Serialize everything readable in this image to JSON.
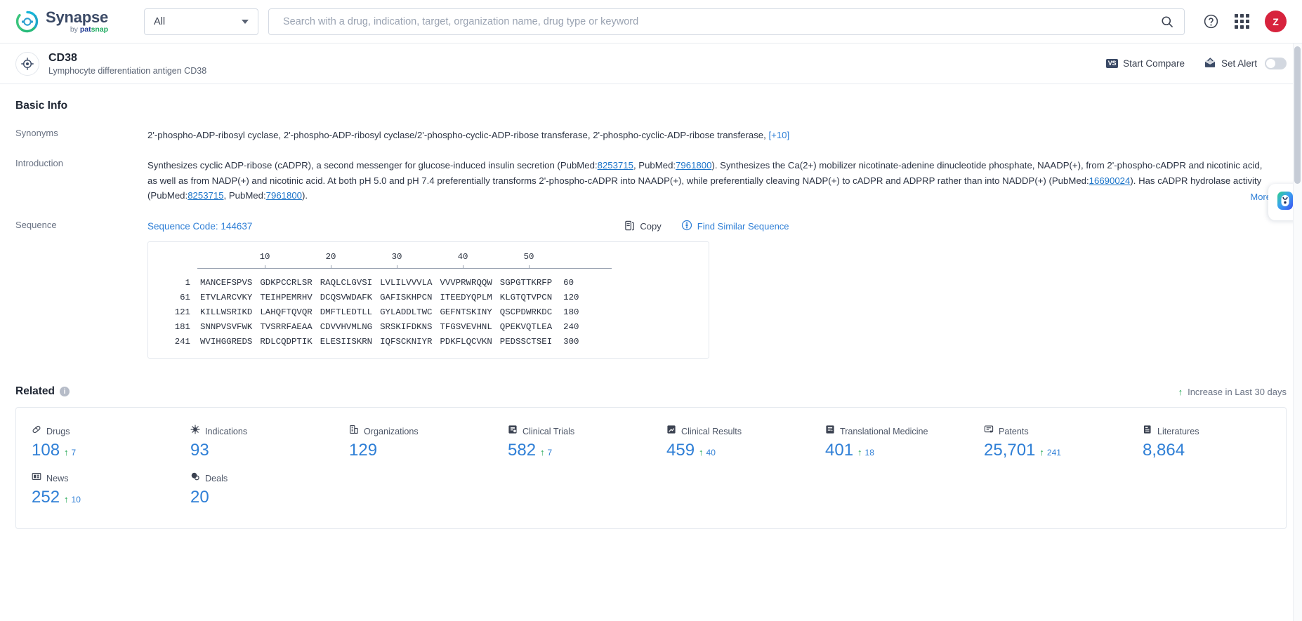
{
  "topnav": {
    "logo_name": "Synapse",
    "logo_by": "by ",
    "logo_pat": "pat",
    "logo_snap": "snap",
    "scope_value": "All",
    "search_placeholder": "Search with a drug, indication, target, organization name, drug type or keyword",
    "avatar_initial": "Z"
  },
  "subheader": {
    "entity_name": "CD38",
    "entity_desc": "Lymphocyte differentiation antigen CD38",
    "start_compare": "Start Compare",
    "vs_badge": "VS",
    "set_alert": "Set Alert"
  },
  "basic_info": {
    "title": "Basic Info",
    "synonyms_label": "Synonyms",
    "synonyms_text": "2'-phospho-ADP-ribosyl cyclase,  2'-phospho-ADP-ribosyl cyclase/2'-phospho-cyclic-ADP-ribose transferase,  2'-phospho-cyclic-ADP-ribose transferase,",
    "synonyms_more": "[+10]",
    "introduction_label": "Introduction",
    "intro_p1": "Synthesizes cyclic ADP-ribose (cADPR), a second messenger for glucose-induced insulin secretion (PubMed:",
    "intro_ref1": "8253715",
    "intro_p2": ", PubMed:",
    "intro_ref2": "7961800",
    "intro_p3": "). Synthesizes the Ca(2+) mobilizer nicotinate-adenine dinucleotide phosphate, NAADP(+), from 2'-phospho-cADPR and nicotinic acid, as well as from NADP(+) and nicotinic acid. At both pH 5.0 and pH 7.4 preferentially transforms 2'-phospho-cADPR into NAADP(+), while preferentially cleaving NADP(+) to cADPR and ADPRP rather than into NADDP(+) (PubMed:",
    "intro_ref3": "16690024",
    "intro_p4": "). Has cADPR hydrolase activity (PubMed:",
    "intro_ref4": "8253715",
    "intro_p5": ", PubMed:",
    "intro_ref5": "7961800",
    "intro_p6": ").",
    "more_label": "More"
  },
  "sequence": {
    "label": "Sequence",
    "code_label": "Sequence Code: 144637",
    "copy_label": "Copy",
    "find_similar_label": "Find Similar Sequence",
    "ruler": [
      "10",
      "20",
      "30",
      "40",
      "50"
    ],
    "rows": [
      {
        "start": "1",
        "chunks": [
          "MANCEFSPVS",
          "GDKPCCRLSR",
          "RAQLCLGVSI",
          "LVLILVVVLA",
          "VVVPRWRQQW",
          "SGPGTTKRFP"
        ],
        "end": "60"
      },
      {
        "start": "61",
        "chunks": [
          "ETVLARCVKY",
          "TEIHPEMRHV",
          "DCQSVWDAFK",
          "GAFISKHPCN",
          "ITEEDYQPLM",
          "KLGTQTVPCN"
        ],
        "end": "120"
      },
      {
        "start": "121",
        "chunks": [
          "KILLWSRIKD",
          "LAHQFTQVQR",
          "DMFTLEDTLL",
          "GYLADDLTWC",
          "GEFNTSKINY",
          "QSCPDWRKDC"
        ],
        "end": "180"
      },
      {
        "start": "181",
        "chunks": [
          "SNNPVSVFWK",
          "TVSRRFAEAA",
          "CDVVHVMLNG",
          "SRSKIFDKNS",
          "TFGSVEVHNL",
          "QPEKVQTLEA"
        ],
        "end": "240"
      },
      {
        "start": "241",
        "chunks": [
          "WVIHGGREDS",
          "RDLCQDPTIK",
          "ELESIISKRN",
          "IQFSCKNIYR",
          "PDKFLQCVKN",
          "PEDSSCTSEI"
        ],
        "end": "300"
      }
    ]
  },
  "related": {
    "title": "Related",
    "info_glyph": "i",
    "increase_note": "Increase in Last 30 days",
    "arrow_glyph": "↑",
    "stats": [
      {
        "label": "Drugs",
        "icon": "pill-icon",
        "value": "108",
        "delta": "7"
      },
      {
        "label": "Indications",
        "icon": "virus-icon",
        "value": "93",
        "delta": ""
      },
      {
        "label": "Organizations",
        "icon": "building-icon",
        "value": "129",
        "delta": ""
      },
      {
        "label": "Clinical Trials",
        "icon": "trial-icon",
        "value": "582",
        "delta": "7"
      },
      {
        "label": "Clinical Results",
        "icon": "results-icon",
        "value": "459",
        "delta": "40"
      },
      {
        "label": "Translational Medicine",
        "icon": "transmed-icon",
        "value": "401",
        "delta": "18"
      },
      {
        "label": "Patents",
        "icon": "patent-icon",
        "value": "25,701",
        "delta": "241"
      },
      {
        "label": "Literatures",
        "icon": "literature-icon",
        "value": "8,864",
        "delta": ""
      },
      {
        "label": "News",
        "icon": "news-icon",
        "value": "252",
        "delta": "10"
      },
      {
        "label": "Deals",
        "icon": "deals-icon",
        "value": "20",
        "delta": ""
      }
    ]
  },
  "colors": {
    "accent_blue": "#2f7fd6",
    "link_blue": "#1a73c8",
    "increase_green": "#16a34a",
    "avatar_red": "#d7233d"
  }
}
